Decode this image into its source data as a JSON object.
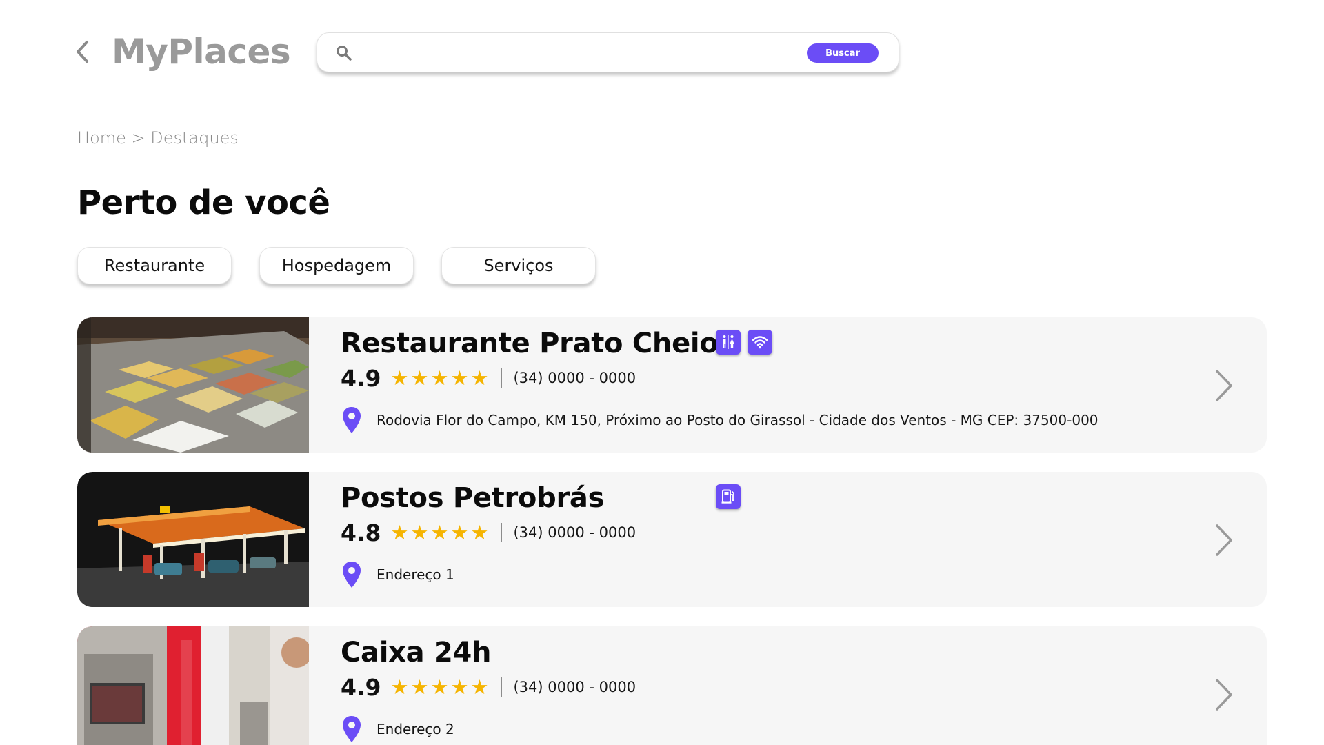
{
  "app": {
    "title": "MyPlaces",
    "accent_color": "#6b4df6",
    "star_color": "#f5b400"
  },
  "header": {
    "back_icon": "chevron-left-icon",
    "search": {
      "placeholder": "",
      "value": "",
      "icon": "search-icon",
      "button_label": "Buscar"
    }
  },
  "breadcrumb": {
    "items": [
      "Home",
      "Destaques"
    ],
    "separator": ">"
  },
  "page": {
    "title": "Perto de você"
  },
  "filters": [
    {
      "label": "Restaurante"
    },
    {
      "label": "Hospedagem"
    },
    {
      "label": "Serviços"
    }
  ],
  "places": [
    {
      "name": "Restaurante Prato Cheio",
      "rating": "4.9",
      "stars": 5,
      "phone": "(34) 0000 - 0000",
      "address": "Rodovia Flor do Campo, KM 150, Próximo ao Posto do Girassol - Cidade dos Ventos - MG CEP: 37500-000",
      "amenities": [
        "restroom-icon",
        "wifi-icon"
      ],
      "image": "buffet-food-trays-photo"
    },
    {
      "name": "Postos Petrobrás",
      "rating": "4.8",
      "stars": 5,
      "phone": "(34) 0000 - 0000",
      "address": "Endereço 1",
      "amenities": [
        "fuel-pump-icon"
      ],
      "image": "gas-station-night-photo"
    },
    {
      "name": "Caixa 24h",
      "rating": "4.9",
      "stars": 5,
      "phone": "(34) 0000 - 0000",
      "address": "Endereço 2",
      "amenities": [],
      "image": "atm-machine-photo"
    }
  ]
}
